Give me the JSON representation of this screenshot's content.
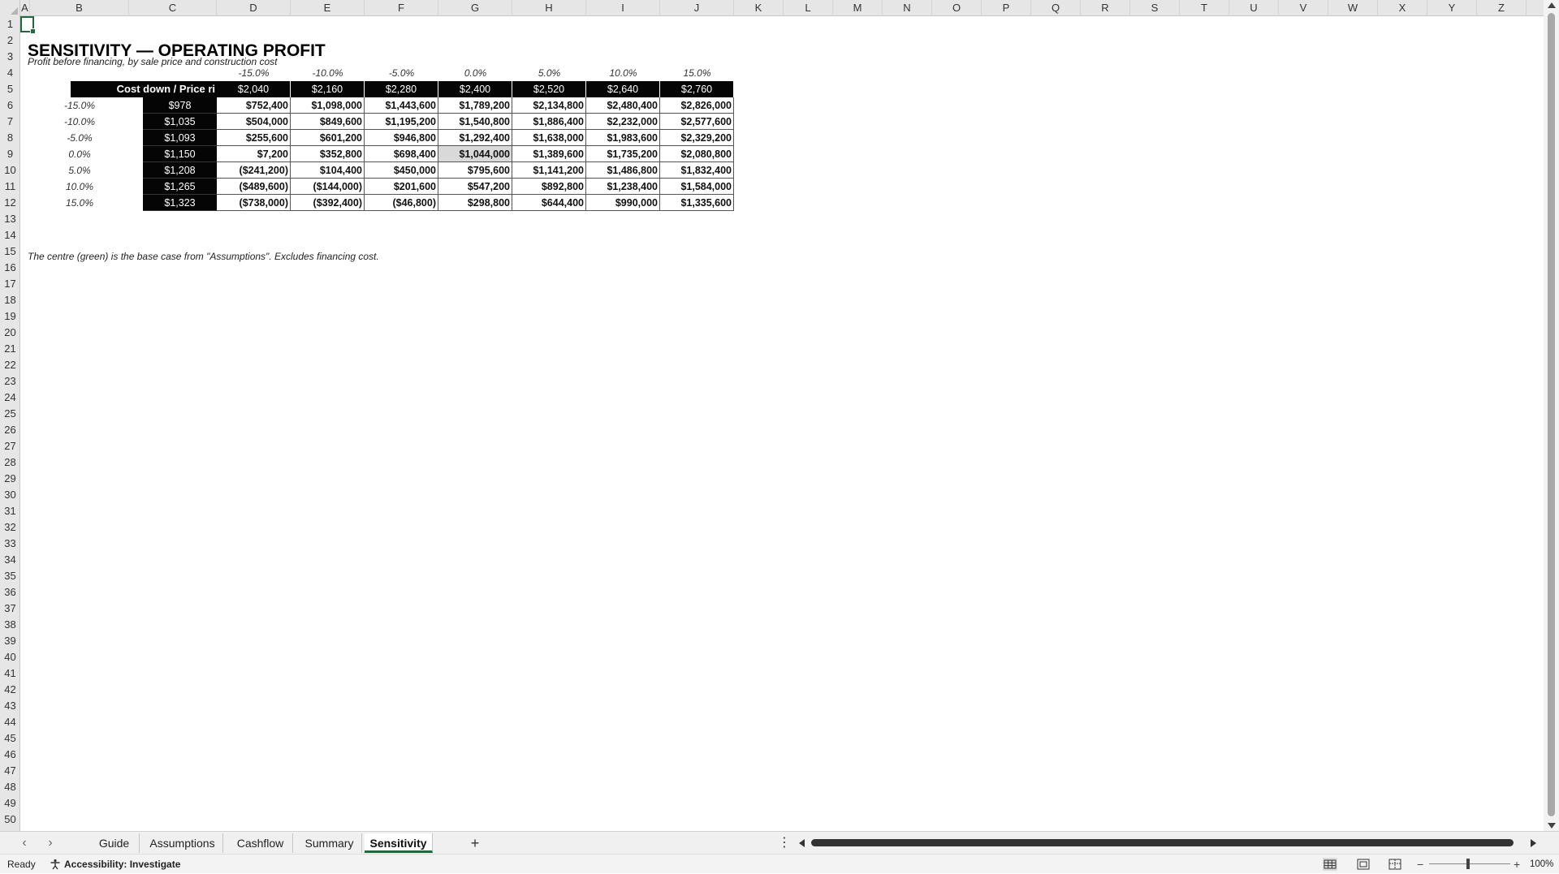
{
  "columns": [
    "A",
    "B",
    "C",
    "D",
    "E",
    "F",
    "G",
    "H",
    "I",
    "J",
    "K",
    "L",
    "M",
    "N",
    "O",
    "P",
    "Q",
    "R",
    "S",
    "T",
    "U",
    "V",
    "W",
    "X",
    "Y",
    "Z"
  ],
  "rows": [
    "1",
    "2",
    "3",
    "4",
    "5",
    "6",
    "7",
    "8",
    "9",
    "10",
    "11",
    "12",
    "13",
    "14",
    "15",
    "16",
    "17",
    "18",
    "19",
    "20",
    "21",
    "22",
    "23",
    "24",
    "25",
    "26",
    "27",
    "28",
    "29",
    "30",
    "31",
    "32",
    "33",
    "34",
    "35",
    "36",
    "37",
    "38",
    "39",
    "40",
    "41",
    "42",
    "43",
    "44",
    "45",
    "46",
    "47",
    "48",
    "49",
    "50"
  ],
  "sheet": {
    "title": "SENSITIVITY — OPERATING PROFIT",
    "subtitle": "Profit before financing, by sale price and construction cost",
    "corner_label": "Cost down / Price ri",
    "price_pct": [
      "-15.0%",
      "-10.0%",
      "-5.0%",
      "0.0%",
      "5.0%",
      "10.0%",
      "15.0%"
    ],
    "price_values": [
      "$2,040",
      "$2,160",
      "$2,280",
      "$2,400",
      "$2,520",
      "$2,640",
      "$2,760"
    ],
    "cost_pct": [
      "-15.0%",
      "-10.0%",
      "-5.0%",
      "0.0%",
      "5.0%",
      "10.0%",
      "15.0%"
    ],
    "cost_values": [
      "$978",
      "$1,035",
      "$1,093",
      "$1,150",
      "$1,208",
      "$1,265",
      "$1,323"
    ],
    "matrix": [
      [
        "$752,400",
        "$1,098,000",
        "$1,443,600",
        "$1,789,200",
        "$2,134,800",
        "$2,480,400",
        "$2,826,000"
      ],
      [
        "$504,000",
        "$849,600",
        "$1,195,200",
        "$1,540,800",
        "$1,886,400",
        "$2,232,000",
        "$2,577,600"
      ],
      [
        "$255,600",
        "$601,200",
        "$946,800",
        "$1,292,400",
        "$1,638,000",
        "$1,983,600",
        "$2,329,200"
      ],
      [
        "$7,200",
        "$352,800",
        "$698,400",
        "$1,044,000",
        "$1,389,600",
        "$1,735,200",
        "$2,080,800"
      ],
      [
        "($241,200)",
        "$104,400",
        "$450,000",
        "$795,600",
        "$1,141,200",
        "$1,486,800",
        "$1,832,400"
      ],
      [
        "($489,600)",
        "($144,000)",
        "$201,600",
        "$547,200",
        "$892,800",
        "$1,238,400",
        "$1,584,000"
      ],
      [
        "($738,000)",
        "($392,400)",
        "($46,800)",
        "$298,800",
        "$644,400",
        "$990,000",
        "$1,335,600"
      ]
    ],
    "note": "The centre (green) is the base case from \"Assumptions\". Excludes financing cost."
  },
  "tabs": [
    "Guide",
    "Assumptions",
    "Cashflow",
    "Summary",
    "Sensitivity"
  ],
  "active_tab": "Sensitivity",
  "add_sheet_label": "+",
  "tab_more_label": "⋮",
  "status": {
    "ready": "Ready",
    "accessibility": "Accessibility: Investigate",
    "zoom_minus": "−",
    "zoom_plus": "+",
    "zoom": "100%"
  },
  "colors": {
    "header_dark": "#050505",
    "base_case": "#d9d9d9",
    "selection": "#1e6b3c"
  },
  "icons": [
    "accessibility-icon",
    "normal-view-icon",
    "page-layout-icon",
    "page-break-icon",
    "prev-sheet-icon",
    "next-sheet-icon"
  ]
}
